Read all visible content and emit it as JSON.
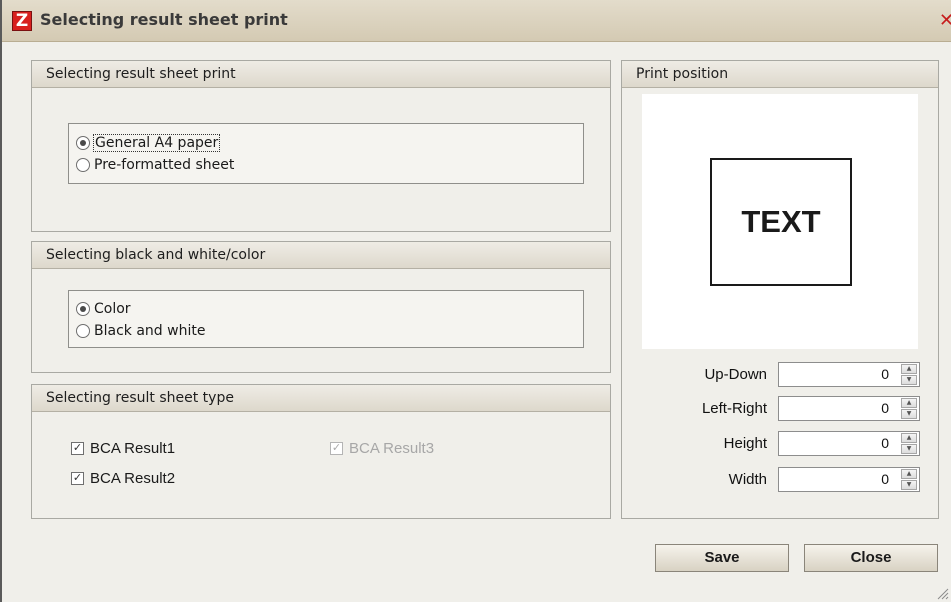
{
  "window": {
    "title": "Selecting result sheet print",
    "app_icon_glyph": "Z",
    "close_glyph": "✕"
  },
  "print_sheet": {
    "header": "Selecting result sheet print",
    "options": [
      {
        "label": "General A4 paper",
        "selected": true
      },
      {
        "label": "Pre-formatted sheet",
        "selected": false
      }
    ]
  },
  "color_mode": {
    "header": "Selecting black and white/color",
    "options": [
      {
        "label": "Color",
        "selected": true
      },
      {
        "label": "Black and white",
        "selected": false
      }
    ]
  },
  "sheet_type": {
    "header": "Selecting result sheet type",
    "items": [
      {
        "label": "BCA Result1",
        "checked": true,
        "enabled": true
      },
      {
        "label": "BCA Result2",
        "checked": true,
        "enabled": true
      },
      {
        "label": "BCA Result3",
        "checked": true,
        "enabled": false
      }
    ]
  },
  "print_position": {
    "header": "Print position",
    "preview_text": "TEXT",
    "fields": [
      {
        "label": "Up-Down",
        "value": "0"
      },
      {
        "label": "Left-Right",
        "value": "0"
      },
      {
        "label": "Height",
        "value": "0"
      },
      {
        "label": "Width",
        "value": "0"
      }
    ]
  },
  "buttons": {
    "save": "Save",
    "close": "Close"
  },
  "colors": {
    "title_bar": "#d9d0bb",
    "close_icon": "#c61b1b",
    "app_icon": "#d8201e",
    "panel_bg": "#f0efea"
  }
}
